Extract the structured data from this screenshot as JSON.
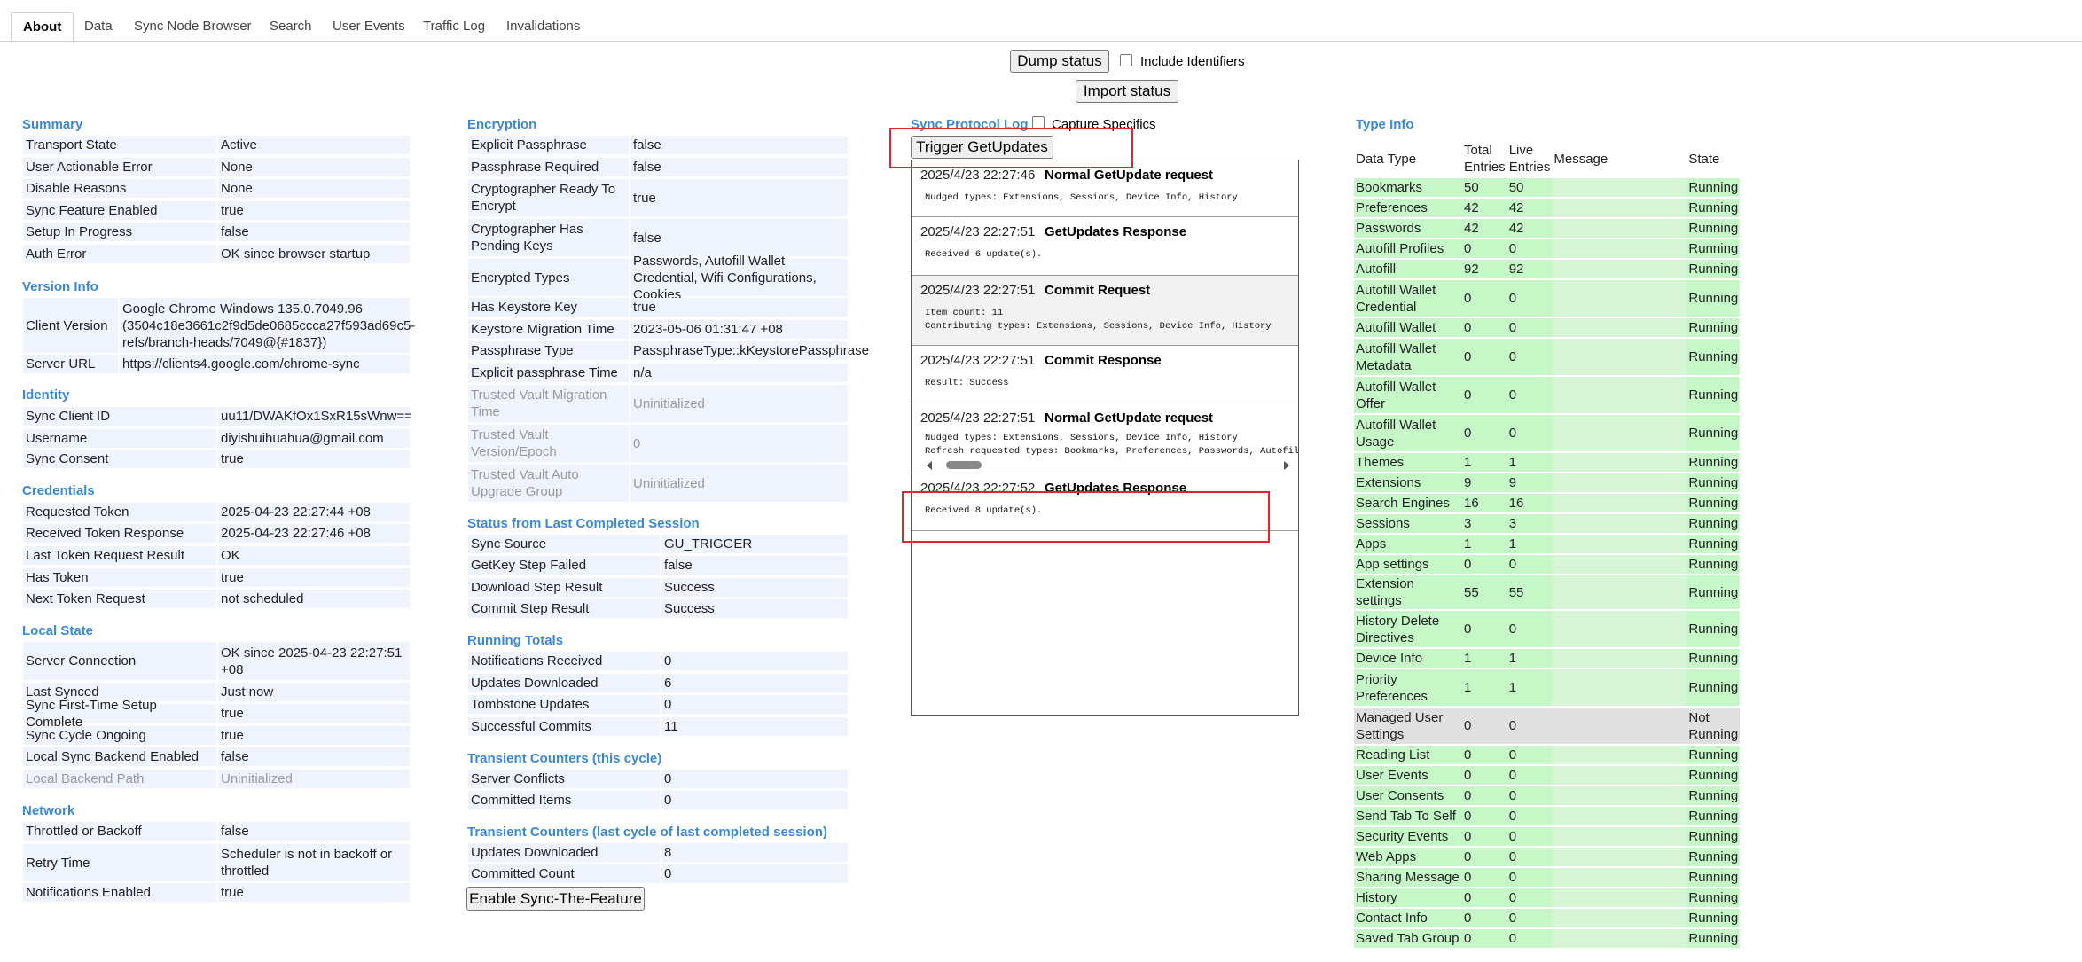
{
  "tabs": [
    "About",
    "Data",
    "Sync Node Browser",
    "Search",
    "User Events",
    "Traffic Log",
    "Invalidations"
  ],
  "controls": {
    "dump_status": "Dump status",
    "include_identifiers": "Include Identifiers",
    "import_status": "Import status"
  },
  "col1": {
    "summary": {
      "title": "Summary",
      "rows": [
        [
          "Transport State",
          "Active"
        ],
        [
          "User Actionable Error",
          "None"
        ],
        [
          "Disable Reasons",
          "None"
        ],
        [
          "Sync Feature Enabled",
          "true"
        ],
        [
          "Setup In Progress",
          "false"
        ],
        [
          "Auth Error",
          "OK since browser startup"
        ]
      ]
    },
    "version": {
      "title": "Version Info",
      "rows": [
        [
          "Client Version",
          "Google Chrome Windows 135.0.7049.96 (3504c18e3661c2f9d5de0685ccca27f593ad69c5-refs/branch-heads/7049@{#1837})"
        ],
        [
          "Server URL",
          "https://clients4.google.com/chrome-sync"
        ]
      ]
    },
    "identity": {
      "title": "Identity",
      "rows": [
        [
          "Sync Client ID",
          "uu11/DWAKfOx1SxR15sWnw=="
        ],
        [
          "Username",
          "diyishuihuahua@gmail.com"
        ],
        [
          "Sync Consent",
          "true"
        ]
      ]
    },
    "credentials": {
      "title": "Credentials",
      "rows": [
        [
          "Requested Token",
          "2025-04-23 22:27:44 +08"
        ],
        [
          "Received Token Response",
          "2025-04-23 22:27:46 +08"
        ],
        [
          "Last Token Request Result",
          "OK"
        ],
        [
          "Has Token",
          "true"
        ],
        [
          "Next Token Request",
          "not scheduled"
        ]
      ]
    },
    "local": {
      "title": "Local State",
      "rows": [
        [
          "Server Connection",
          "OK since 2025-04-23 22:27:51 +08"
        ],
        [
          "Last Synced",
          "Just now"
        ],
        [
          "Sync First-Time Setup Complete",
          "true"
        ],
        [
          "Sync Cycle Ongoing",
          "true"
        ],
        [
          "Local Sync Backend Enabled",
          "false"
        ],
        [
          "Local Backend Path",
          "Uninitialized"
        ]
      ]
    },
    "network": {
      "title": "Network",
      "rows": [
        [
          "Throttled or Backoff",
          "false"
        ],
        [
          "Retry Time",
          "Scheduler is not in backoff or throttled"
        ],
        [
          "Notifications Enabled",
          "true"
        ]
      ]
    }
  },
  "col2": {
    "encryption": {
      "title": "Encryption",
      "rows": [
        [
          "Explicit Passphrase",
          "false"
        ],
        [
          "Passphrase Required",
          "false"
        ],
        [
          "Cryptographer Ready To Encrypt",
          "true"
        ],
        [
          "Cryptographer Has Pending Keys",
          "false"
        ],
        [
          "Encrypted Types",
          "Passwords, Autofill Wallet Credential, Wifi Configurations, Cookies"
        ],
        [
          "Has Keystore Key",
          "true"
        ],
        [
          "Keystore Migration Time",
          "2023-05-06 01:31:47 +08"
        ],
        [
          "Passphrase Type",
          "PassphraseType::kKeystorePassphrase"
        ],
        [
          "Explicit passphrase Time",
          "n/a"
        ],
        [
          "Trusted Vault Migration Time",
          "Uninitialized"
        ],
        [
          "Trusted Vault Version/Epoch",
          "0"
        ],
        [
          "Trusted Vault Auto Upgrade Group",
          "Uninitialized"
        ]
      ]
    },
    "status": {
      "title": "Status from Last Completed Session",
      "rows": [
        [
          "Sync Source",
          "GU_TRIGGER"
        ],
        [
          "GetKey Step Failed",
          "false"
        ],
        [
          "Download Step Result",
          "Success"
        ],
        [
          "Commit Step Result",
          "Success"
        ]
      ]
    },
    "totals": {
      "title": "Running Totals",
      "rows": [
        [
          "Notifications Received",
          "0"
        ],
        [
          "Updates Downloaded",
          "6"
        ],
        [
          "Tombstone Updates",
          "0"
        ],
        [
          "Successful Commits",
          "11"
        ]
      ]
    },
    "transient": {
      "title": "Transient Counters (this cycle)",
      "rows": [
        [
          "Server Conflicts",
          "0"
        ],
        [
          "Committed Items",
          "0"
        ]
      ]
    },
    "transient_last": {
      "title": "Transient Counters (last cycle of last completed session)",
      "rows": [
        [
          "Updates Downloaded",
          "8"
        ],
        [
          "Committed Count",
          "0"
        ]
      ]
    },
    "enable_button": "Enable Sync-The-Feature"
  },
  "protocol_log": {
    "title": "Sync Protocol Log",
    "capture_label": "Capture Specifics",
    "trigger_button": "Trigger GetUpdates",
    "entries": [
      {
        "time": "2025/4/23 22:27:46",
        "title": "Normal GetUpdate request",
        "details": "Nudged types: Extensions, Sessions, Device Info, History"
      },
      {
        "time": "2025/4/23 22:27:51",
        "title": "GetUpdates Response",
        "details": "Received 6 update(s)."
      },
      {
        "time": "2025/4/23 22:27:51",
        "title": "Commit Request",
        "details": "Item count: 11\nContributing types: Extensions, Sessions, Device Info, History"
      },
      {
        "time": "2025/4/23 22:27:51",
        "title": "Commit Response",
        "details": "Result: Success"
      },
      {
        "time": "2025/4/23 22:27:51",
        "title": "Normal GetUpdate request",
        "details": "Nudged types: Extensions, Sessions, Device Info, History\nRefresh requested types: Bookmarks, Preferences, Passwords, Autofill"
      },
      {
        "time": "2025/4/23 22:27:52",
        "title": "GetUpdates Response",
        "details": "Received 8 update(s)."
      }
    ]
  },
  "type_info": {
    "title": "Type Info",
    "headers": [
      "Data Type",
      "Total Entries",
      "Live Entries",
      "Message",
      "State"
    ],
    "rows": [
      [
        "Bookmarks",
        "50",
        "50",
        "",
        "Running"
      ],
      [
        "Preferences",
        "42",
        "42",
        "",
        "Running"
      ],
      [
        "Passwords",
        "42",
        "42",
        "",
        "Running"
      ],
      [
        "Autofill Profiles",
        "0",
        "0",
        "",
        "Running"
      ],
      [
        "Autofill",
        "92",
        "92",
        "",
        "Running"
      ],
      [
        "Autofill Wallet Credential",
        "0",
        "0",
        "",
        "Running"
      ],
      [
        "Autofill Wallet",
        "0",
        "0",
        "",
        "Running"
      ],
      [
        "Autofill Wallet Metadata",
        "0",
        "0",
        "",
        "Running"
      ],
      [
        "Autofill Wallet Offer",
        "0",
        "0",
        "",
        "Running"
      ],
      [
        "Autofill Wallet Usage",
        "0",
        "0",
        "",
        "Running"
      ],
      [
        "Themes",
        "1",
        "1",
        "",
        "Running"
      ],
      [
        "Extensions",
        "9",
        "9",
        "",
        "Running"
      ],
      [
        "Search Engines",
        "16",
        "16",
        "",
        "Running"
      ],
      [
        "Sessions",
        "3",
        "3",
        "",
        "Running"
      ],
      [
        "Apps",
        "1",
        "1",
        "",
        "Running"
      ],
      [
        "App settings",
        "0",
        "0",
        "",
        "Running"
      ],
      [
        "Extension settings",
        "55",
        "55",
        "",
        "Running"
      ],
      [
        "History Delete Directives",
        "0",
        "0",
        "",
        "Running"
      ],
      [
        "Device Info",
        "1",
        "1",
        "",
        "Running"
      ],
      [
        "Priority Preferences",
        "1",
        "1",
        "",
        "Running"
      ],
      [
        "Managed User Settings",
        "0",
        "0",
        "",
        "Not Running"
      ],
      [
        "Reading List",
        "0",
        "0",
        "",
        "Running"
      ],
      [
        "User Events",
        "0",
        "0",
        "",
        "Running"
      ],
      [
        "User Consents",
        "0",
        "0",
        "",
        "Running"
      ],
      [
        "Send Tab To Self",
        "0",
        "0",
        "",
        "Running"
      ],
      [
        "Security Events",
        "0",
        "0",
        "",
        "Running"
      ],
      [
        "Web Apps",
        "0",
        "0",
        "",
        "Running"
      ],
      [
        "Sharing Message",
        "0",
        "0",
        "",
        "Running"
      ],
      [
        "History",
        "0",
        "0",
        "",
        "Running"
      ],
      [
        "Contact Info",
        "0",
        "0",
        "",
        "Running"
      ],
      [
        "Saved Tab Group",
        "0",
        "0",
        "",
        "Running"
      ]
    ]
  }
}
